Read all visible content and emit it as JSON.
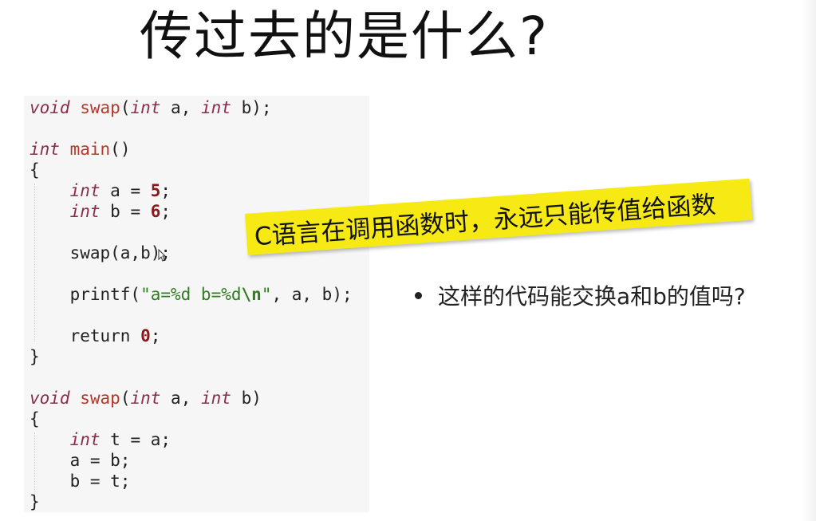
{
  "slide": {
    "title": "传过去的是什么?",
    "banner": "C语言在调用函数时，永远只能传值给函数",
    "bullet": "这样的代码能交换a和b的值吗?"
  },
  "code_lines": [
    [
      [
        "kw",
        "void"
      ],
      [
        "plain",
        " "
      ],
      [
        "fn",
        "swap"
      ],
      [
        "plain",
        "("
      ],
      [
        "kw",
        "int"
      ],
      [
        "plain",
        " a, "
      ],
      [
        "kw",
        "int"
      ],
      [
        "plain",
        " b);"
      ]
    ],
    [],
    [
      [
        "kw",
        "int"
      ],
      [
        "plain",
        " "
      ],
      [
        "fn",
        "main"
      ],
      [
        "plain",
        "()"
      ]
    ],
    [
      [
        "plain",
        "{"
      ]
    ],
    [
      [
        "plain",
        "    "
      ],
      [
        "kw",
        "int"
      ],
      [
        "plain",
        " a = "
      ],
      [
        "num",
        "5"
      ],
      [
        "plain",
        ";"
      ]
    ],
    [
      [
        "plain",
        "    "
      ],
      [
        "kw",
        "int"
      ],
      [
        "plain",
        " b = "
      ],
      [
        "num",
        "6"
      ],
      [
        "plain",
        ";"
      ]
    ],
    [],
    [
      [
        "plain",
        "    swap(a,b);"
      ]
    ],
    [],
    [
      [
        "plain",
        "    printf("
      ],
      [
        "str",
        "\"a=%d b=%d"
      ],
      [
        "esc",
        "\\n"
      ],
      [
        "str",
        "\""
      ],
      [
        "plain",
        ", a, b);"
      ]
    ],
    [],
    [
      [
        "plain",
        "    return "
      ],
      [
        "num",
        "0"
      ],
      [
        "plain",
        ";"
      ]
    ],
    [
      [
        "plain",
        "}"
      ]
    ],
    [],
    [
      [
        "kw",
        "void"
      ],
      [
        "plain",
        " "
      ],
      [
        "fn",
        "swap"
      ],
      [
        "plain",
        "("
      ],
      [
        "kw",
        "int"
      ],
      [
        "plain",
        " a, "
      ],
      [
        "kw",
        "int"
      ],
      [
        "plain",
        " b)"
      ]
    ],
    [
      [
        "plain",
        "{"
      ]
    ],
    [
      [
        "plain",
        "    "
      ],
      [
        "kw",
        "int"
      ],
      [
        "plain",
        " t = a;"
      ]
    ],
    [
      [
        "plain",
        "    a = b;"
      ]
    ],
    [
      [
        "plain",
        "    b = t;"
      ]
    ],
    [
      [
        "plain",
        "}"
      ]
    ]
  ]
}
